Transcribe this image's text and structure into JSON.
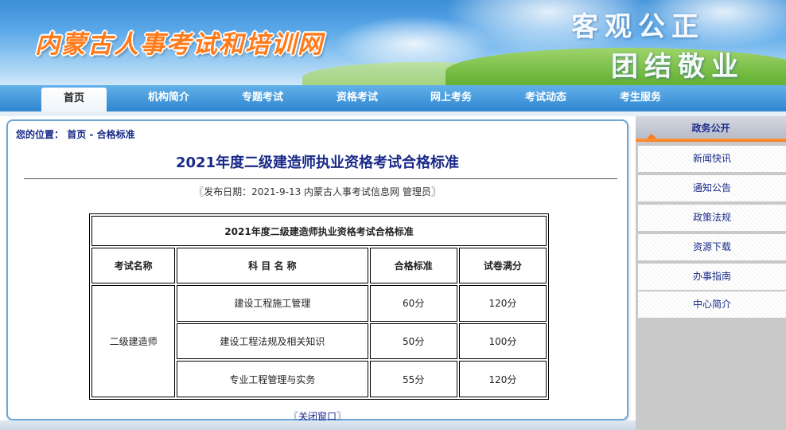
{
  "header": {
    "site_title": "内蒙古人事考试和培训网",
    "slogan_line1": "客观公正",
    "slogan_line2": "团结敬业"
  },
  "nav": {
    "items": [
      "首页",
      "机构简介",
      "专题考试",
      "资格考试",
      "网上考务",
      "考试动态",
      "考生服务"
    ],
    "active_index": 0
  },
  "breadcrumb": {
    "prefix": "您的位置：",
    "home": "首页",
    "separator": " - ",
    "current": "合格标准"
  },
  "article": {
    "title": "2021年度二级建造师执业资格考试合格标准",
    "pub_info": "〖发布日期：2021-9-13 内蒙古人事考试信息网 管理员〗",
    "close_label": "〖关闭窗口〗"
  },
  "table": {
    "caption": "2021年度二级建造师执业资格考试合格标准",
    "headers": [
      "考试名称",
      "科 目 名 称",
      "合格标准",
      "试卷满分"
    ],
    "exam_name": "二级建造师",
    "rows": [
      {
        "subject": "建设工程施工管理",
        "pass": "60分",
        "full": "120分"
      },
      {
        "subject": "建设工程法规及相关知识",
        "pass": "50分",
        "full": "100分"
      },
      {
        "subject": "专业工程管理与实务",
        "pass": "55分",
        "full": "120分"
      }
    ]
  },
  "sidebar": {
    "heading": "政务公开",
    "items": [
      "新闻快讯",
      "通知公告",
      "政策法规",
      "资源下载",
      "办事指南",
      "中心简介"
    ]
  },
  "colors": {
    "accent_orange": "#ff7a1a",
    "link_navy": "#1a2a88",
    "nav_blue": "#2f86cf"
  }
}
